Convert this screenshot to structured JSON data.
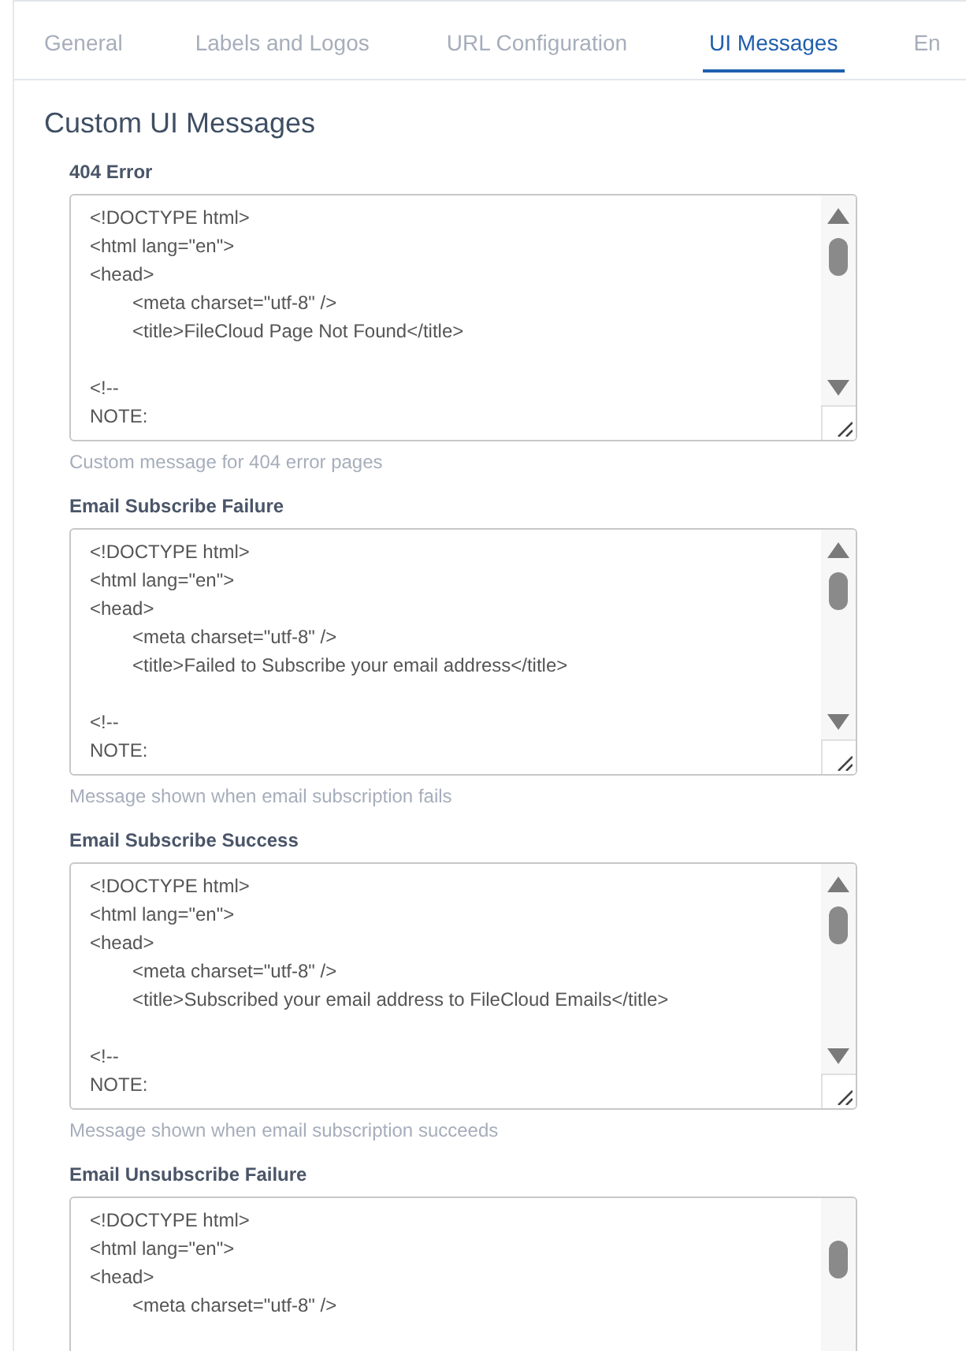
{
  "tabs": [
    {
      "label": "General",
      "selected": false
    },
    {
      "label": "Labels and Logos",
      "selected": false
    },
    {
      "label": "URL Configuration",
      "selected": false
    },
    {
      "label": "UI Messages",
      "selected": true
    },
    {
      "label": "En",
      "selected": false
    }
  ],
  "section_title": "Custom UI Messages",
  "messages": [
    {
      "label": "404 Error",
      "lines": [
        {
          "kind": "line",
          "text": "<!DOCTYPE html>"
        },
        {
          "kind": "line",
          "text": "<html lang=\"en\">"
        },
        {
          "kind": "line",
          "text": "<head>"
        },
        {
          "kind": "indented",
          "text": "<meta charset=\"utf-8\" />"
        },
        {
          "kind": "indented",
          "text": "<title>FileCloud Page Not Found</title>"
        },
        {
          "kind": "blank"
        },
        {
          "kind": "line",
          "text": "<!--"
        },
        {
          "kind": "line",
          "text": "NOTE:"
        }
      ],
      "help": "Custom message for 404 error pages"
    },
    {
      "label": "Email Subscribe Failure",
      "lines": [
        {
          "kind": "line",
          "text": "<!DOCTYPE html>"
        },
        {
          "kind": "line",
          "text": "<html lang=\"en\">"
        },
        {
          "kind": "line",
          "text": "<head>"
        },
        {
          "kind": "indented",
          "text": "<meta charset=\"utf-8\" />"
        },
        {
          "kind": "indented",
          "text": "<title>Failed to Subscribe your email address</title>"
        },
        {
          "kind": "blank"
        },
        {
          "kind": "line",
          "text": "<!--"
        },
        {
          "kind": "line",
          "text": "NOTE:"
        }
      ],
      "help": "Message shown when email subscription fails"
    },
    {
      "label": "Email Subscribe Success",
      "lines": [
        {
          "kind": "line",
          "text": "<!DOCTYPE html>"
        },
        {
          "kind": "line",
          "text": "<html lang=\"en\">"
        },
        {
          "kind": "line",
          "text": "<head>"
        },
        {
          "kind": "indented",
          "text": "<meta charset=\"utf-8\" />"
        },
        {
          "kind": "indented",
          "text": "<title>Subscribed your email address to FileCloud Emails</title>"
        },
        {
          "kind": "blank"
        },
        {
          "kind": "line",
          "text": "<!--"
        },
        {
          "kind": "line",
          "text": "NOTE:"
        }
      ],
      "help": "Message shown when email subscription succeeds"
    },
    {
      "label": "Email Unsubscribe Failure",
      "lines": [
        {
          "kind": "line",
          "text": "<!DOCTYPE html>"
        },
        {
          "kind": "line",
          "text": "<html lang=\"en\">"
        },
        {
          "kind": "line",
          "text": "<head>"
        },
        {
          "kind": "indented",
          "text": "<meta charset=\"utf-8\" />"
        }
      ]
    }
  ]
}
